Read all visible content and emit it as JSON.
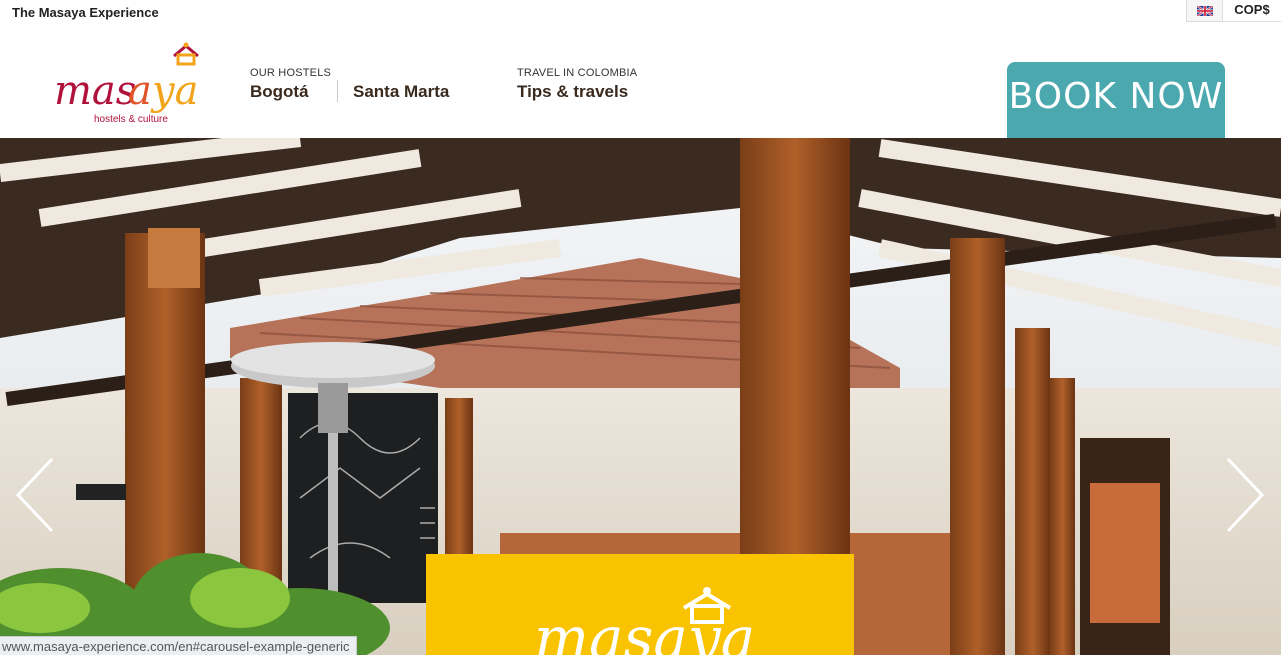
{
  "topbar": {
    "site_name": "The Masaya Experience",
    "currency": "COP$",
    "language_flag": "uk-flag-icon"
  },
  "header": {
    "logo_text": "masaya",
    "logo_tagline": "hostels & culture",
    "nav": {
      "hostels_label": "OUR HOSTELS",
      "bogota": "Bogotá",
      "santa_marta": "Santa Marta",
      "travel_label": "TRAVEL IN COLOMBIA",
      "tips": "Tips & travels"
    },
    "book_now": "BOOK NOW"
  },
  "hero": {
    "prev_icon": "chevron-left-icon",
    "next_icon": "chevron-right-icon",
    "promo_logo_text": "masaya"
  },
  "status_url": "www.masaya-experience.com/en#carousel-example-generic",
  "colors": {
    "book_button": "#4aa8ae",
    "promo_yellow": "#f9c300",
    "logo_red": "#b0123c",
    "logo_orange": "#f2a31a"
  }
}
